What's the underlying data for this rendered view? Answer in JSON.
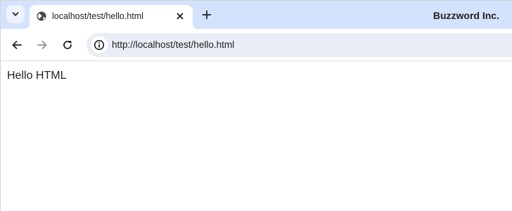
{
  "tabstrip": {
    "tab_search_icon": "chevron-down-icon",
    "active_tab": {
      "title": "localhost/test/hello.html",
      "favicon": "globe-icon",
      "close_icon": "close-icon"
    },
    "new_tab_icon": "plus-icon",
    "profile_name": "Buzzword Inc."
  },
  "toolbar": {
    "back_icon": "arrow-left-icon",
    "forward_icon": "arrow-right-icon",
    "reload_icon": "reload-icon",
    "site_info_icon": "info-icon",
    "url": "http://localhost/test/hello.html"
  },
  "page": {
    "text": "Hello HTML"
  },
  "colors": {
    "tabstrip_bg": "#d3e3fd",
    "omnibox_bg": "#e9eef6",
    "text": "#1f1f1f"
  }
}
